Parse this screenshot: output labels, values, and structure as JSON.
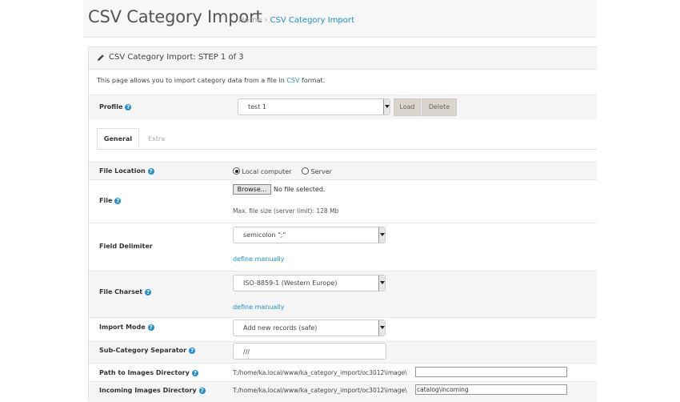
{
  "header": {
    "title": "CSV Category Import",
    "breadcrumb": {
      "home": "Home",
      "separator": "›",
      "current": "CSV Category Import"
    }
  },
  "panel": {
    "title": "CSV Category Import: STEP 1 of 3",
    "icon": "pencil-icon",
    "intro_before": "This page allows you to import category data from a file in ",
    "intro_link": "CSV",
    "intro_after": " format."
  },
  "profile": {
    "label": "Profile",
    "value": "test 1",
    "load_label": "Load",
    "delete_label": "Delete"
  },
  "tabs": [
    {
      "label": "General",
      "active": true
    },
    {
      "label": "Extra",
      "active": false
    }
  ],
  "form": {
    "file_location": {
      "label": "File Location",
      "options": [
        "Local computer",
        "Server"
      ],
      "selected": "Local computer"
    },
    "file": {
      "label": "File",
      "browse_label": "Browse...",
      "status": "No file selected.",
      "hint": "Max. file size (server limit): 128 Mb"
    },
    "field_delimiter": {
      "label": "Field Delimiter",
      "value": "semicolon \";\"",
      "link": "define manually"
    },
    "file_charset": {
      "label": "File Charset",
      "value": "ISO-8859-1 (Western Europe)",
      "link": "define manually"
    },
    "import_mode": {
      "label": "Import Mode",
      "value": "Add new records (safe)"
    },
    "subcategory_separator": {
      "label": "Sub-Category Separator",
      "value": "///"
    },
    "images_dir": {
      "label": "Path to Images Directory",
      "prefix": "T:/home/ka.local/www/ka_category_import/oc3012\\image\\",
      "value": ""
    },
    "incoming_dir": {
      "label": "Incoming Images Directory",
      "prefix": "T:/home/ka.local/www/ka_category_import/oc3012\\image\\",
      "value": "catalog\\incoming"
    }
  },
  "colors": {
    "accent": "#1e91cf",
    "button": "#d9d4cc",
    "row_shade": "#f5f5f5"
  }
}
